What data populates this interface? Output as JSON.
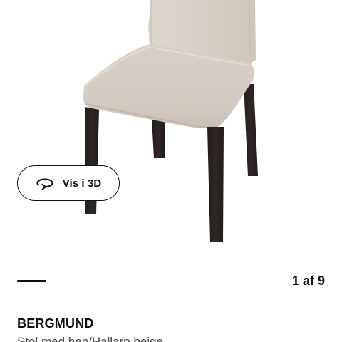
{
  "product_gallery": {
    "image_alt": "Stol med ben/Hallarp beige",
    "view_3d": {
      "label": "Vis i 3D",
      "icon": "rotate-3d-icon"
    },
    "carousel": {
      "current": "1",
      "separator": "af",
      "total": "9",
      "progress_fraction": 0.111
    }
  },
  "product": {
    "name": "BERGMUND",
    "description": "Stol med ben/Hallarp beige"
  },
  "colors": {
    "chair_fabric": "#d9d1c7",
    "chair_legs": "#2d2523",
    "text": "#111111",
    "track": "#dfdfdf"
  }
}
